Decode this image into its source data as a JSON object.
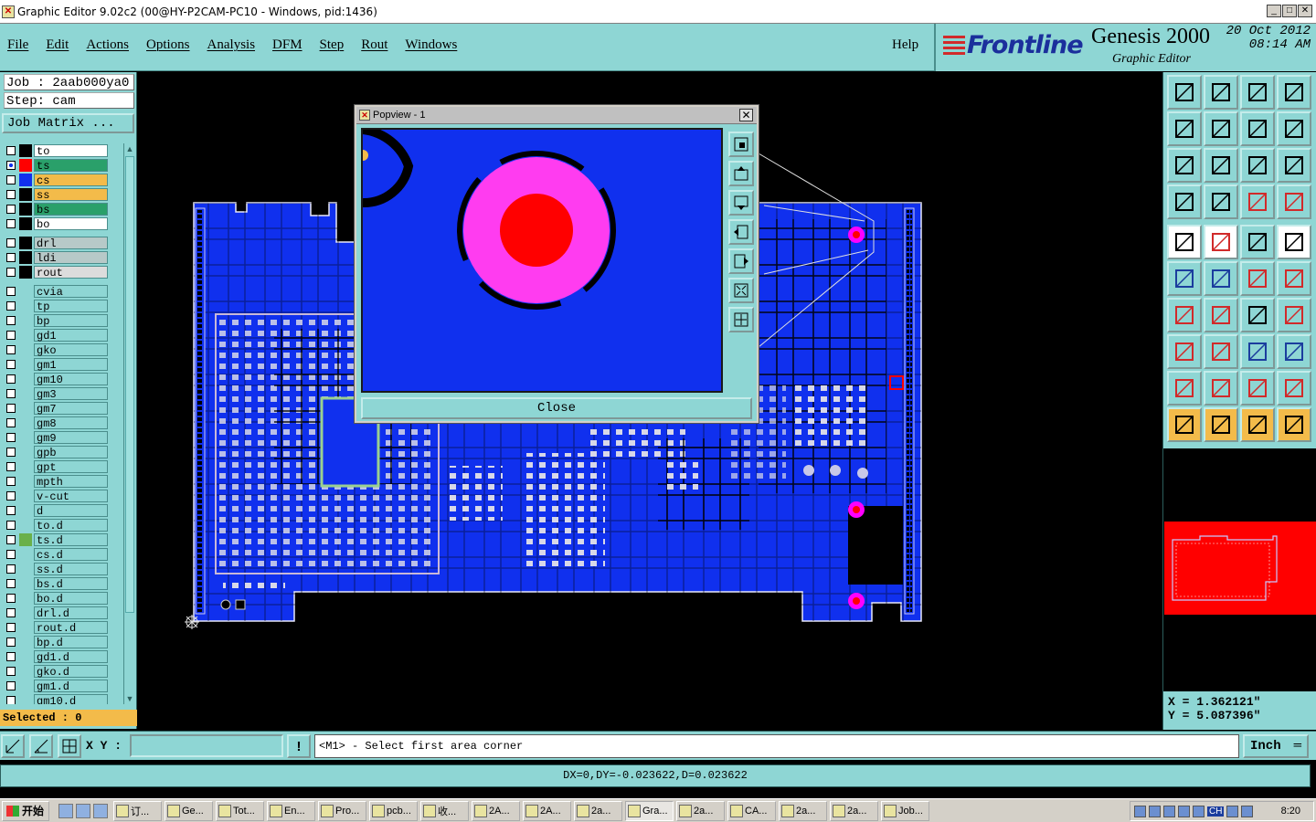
{
  "window": {
    "title": "Graphic Editor 9.02c2 (00@HY-P2CAM-PC10 - Windows, pid:1436)"
  },
  "menu": [
    "File",
    "Edit",
    "Actions",
    "Options",
    "Analysis",
    "DFM",
    "Step",
    "Rout",
    "Windows"
  ],
  "help_label": "Help",
  "brand": {
    "logo": "Frontline",
    "product": "Genesis 2000",
    "subtitle": "Graphic Editor",
    "date": "20 Oct 2012",
    "time": "08:14 AM"
  },
  "job": {
    "job_line": "Job : 2aab000ya0",
    "step_line": "Step: cam",
    "matrix_button": "Job Matrix ..."
  },
  "layers": [
    {
      "name": "to",
      "color": "#ffffff",
      "swatch": "#000000",
      "arrow": "⬋"
    },
    {
      "name": "ts",
      "color": "#2aa06a",
      "swatch": "#ff0000",
      "arrow": "▪",
      "checked": true
    },
    {
      "name": "cs",
      "color": "#f3bb4a",
      "swatch": "#1030ee",
      "arrow": "⬋"
    },
    {
      "name": "ss",
      "color": "#f3bb4a",
      "swatch": "#000000",
      "arrow": "⬋"
    },
    {
      "name": "bs",
      "color": "#2aa06a",
      "swatch": "#000000",
      "arrow": ""
    },
    {
      "name": "bo",
      "color": "#ffffff",
      "swatch": "#000000",
      "arrow": "⬋"
    },
    {
      "gap": true
    },
    {
      "name": "drl",
      "color": "#b7c9c8",
      "swatch": "#000000",
      "arrow": ""
    },
    {
      "name": "ldi",
      "color": "#b7c9c8",
      "swatch": "#000000",
      "arrow": ""
    },
    {
      "name": "rout",
      "color": "#dcdcdc",
      "swatch": "#000000",
      "arrow": ""
    },
    {
      "gap": true
    },
    {
      "name": "cvia",
      "arrow": ""
    },
    {
      "name": "tp",
      "arrow": ""
    },
    {
      "name": "bp",
      "arrow": ""
    },
    {
      "name": "gd1",
      "arrow": "⬋"
    },
    {
      "name": "gko",
      "arrow": ""
    },
    {
      "name": "gm1",
      "arrow": "⬋"
    },
    {
      "name": "gm10",
      "arrow": "⬋"
    },
    {
      "name": "gm3",
      "arrow": ""
    },
    {
      "name": "gm7",
      "arrow": ""
    },
    {
      "name": "gm8",
      "arrow": "⬋"
    },
    {
      "name": "gm9",
      "arrow": ""
    },
    {
      "name": "gpb",
      "arrow": ""
    },
    {
      "name": "gpt",
      "arrow": ""
    },
    {
      "name": "mpth",
      "arrow": ""
    },
    {
      "name": "v-cut",
      "arrow": ""
    },
    {
      "name": "d",
      "arrow": ""
    },
    {
      "name": "to.d",
      "arrow": "⬋"
    },
    {
      "name": "ts.d",
      "arrow": "",
      "swatch": "#6ab04a"
    },
    {
      "name": "cs.d",
      "arrow": "⬋"
    },
    {
      "name": "ss.d",
      "arrow": "⬋"
    },
    {
      "name": "bs.d",
      "arrow": ""
    },
    {
      "name": "bo.d",
      "arrow": "⬋"
    },
    {
      "name": "drl.d",
      "arrow": ""
    },
    {
      "name": "rout.d",
      "arrow": ""
    },
    {
      "name": "bp.d",
      "arrow": ""
    },
    {
      "name": "gd1.d",
      "arrow": "⬋"
    },
    {
      "name": "gko.d",
      "arrow": ""
    },
    {
      "name": "gm1.d",
      "arrow": "⬋"
    },
    {
      "name": "gm10.d",
      "arrow": ""
    }
  ],
  "selected_label": "Selected : 0",
  "popview": {
    "title": "Popview - 1",
    "close_label": "Close",
    "close_x": "✕"
  },
  "coords": {
    "x": "X = 1.362121\"",
    "y": "Y = 5.087396\""
  },
  "cmd": {
    "xy_label": "X Y :",
    "xy_value": "",
    "prompt": "<M1> - Select first area corner",
    "units": "Inch",
    "units_dash": "═"
  },
  "status": "DX=0,DY=-0.023622,D=0.023622",
  "taskbar": {
    "start": "开始",
    "tasks": [
      "订...",
      "Ge...",
      "Tot...",
      "En...",
      "Pro...",
      "pcb...",
      "收...",
      "2A...",
      "2A...",
      "2a...",
      "Gra...",
      "2a...",
      "CA...",
      "2a...",
      "2a...",
      "Job..."
    ],
    "active_task": 10,
    "ime": "CH",
    "time": "8:20"
  },
  "colors": {
    "panel": "#8ed6d4",
    "board": "#1030ee",
    "pad": "#ff00ff",
    "drill": "#ff0000",
    "highlight": "#f3bb4a"
  }
}
